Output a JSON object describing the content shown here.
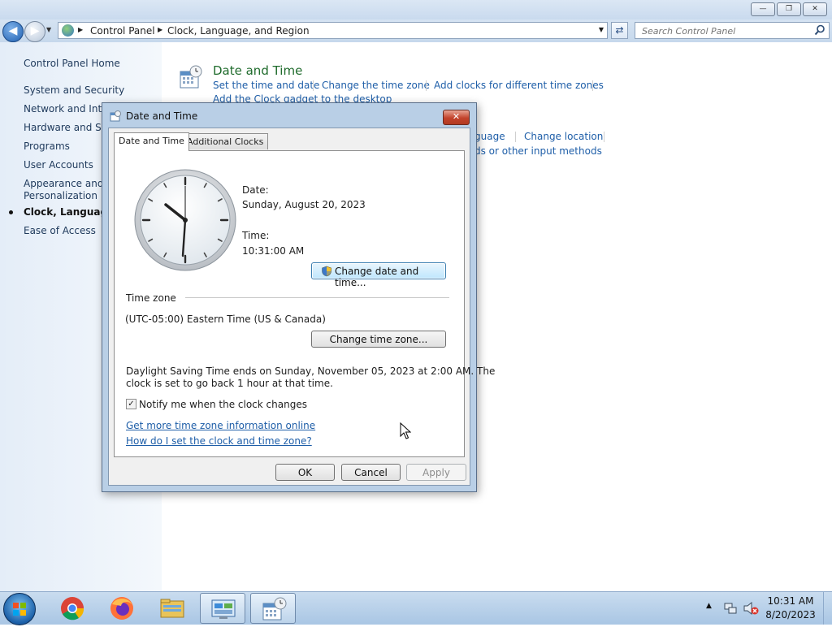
{
  "window": {
    "minimize_glyph": "—",
    "maximize_glyph": "❐",
    "close_glyph": "✕"
  },
  "address_bar": {
    "breadcrumbs": [
      "Control Panel",
      "Clock, Language, and Region"
    ],
    "search_placeholder": "Search Control Panel"
  },
  "sidebar": {
    "home": "Control Panel Home",
    "items": [
      {
        "label": "System and Security"
      },
      {
        "label": "Network and Inter"
      },
      {
        "label": "Hardware and Sou"
      },
      {
        "label": "Programs"
      },
      {
        "label": "User Accounts"
      },
      {
        "label": "Appearance and"
      },
      {
        "label": "Personalization"
      },
      {
        "label": "Clock, Language, a",
        "current": true
      },
      {
        "label": "Ease of Access"
      }
    ]
  },
  "main": {
    "category_title": "Date and Time",
    "links_row1": [
      "Set the time and date",
      "Change the time zone",
      "Add clocks for different time zones"
    ],
    "links_row2": [
      "Add the Clock gadget to the desktop"
    ],
    "region_partial_row1": [
      "guage",
      "Change location"
    ],
    "region_partial_row2": [
      "ds or other input methods"
    ]
  },
  "dialog": {
    "title": "Date and Time",
    "close_glyph": "✕",
    "tabs": [
      "Date and Time",
      "Additional Clocks"
    ],
    "date_label": "Date:",
    "date_value": "Sunday, August 20, 2023",
    "time_label": "Time:",
    "time_value": "10:31:00 AM",
    "change_datetime_button": "Change date and time...",
    "timezone_heading": "Time zone",
    "timezone_value": "(UTC-05:00) Eastern Time (US & Canada)",
    "change_timezone_button": "Change time zone...",
    "dst_line1": "Daylight Saving Time ends on Sunday, November 05, 2023 at 2:00 AM. The",
    "dst_line2": "clock is set to go back 1 hour at that time.",
    "notify_checkbox_label": "Notify me when the clock changes",
    "notify_checked": true,
    "link_more_info": "Get more time zone information online",
    "link_how_to": "How do I set the clock and time zone?",
    "ok_button": "OK",
    "cancel_button": "Cancel",
    "apply_button": "Apply"
  },
  "taskbar": {
    "apps": [
      "chrome-icon",
      "firefox-icon",
      "file-explorer-icon",
      "control-panel-icon",
      "date-time-icon"
    ],
    "clock_time": "10:31 AM",
    "clock_date": "8/20/2023"
  },
  "colors": {
    "link": "#1e5ea8",
    "category_title": "#1f6b2c",
    "dialog_frame": "#b9cfe6"
  }
}
